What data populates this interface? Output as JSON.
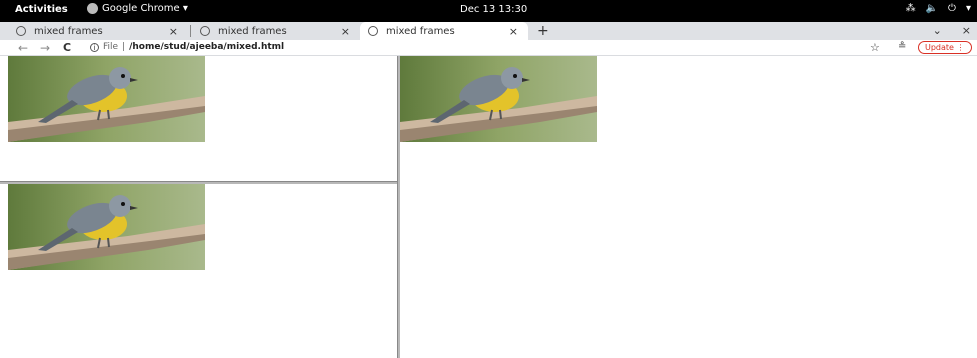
{
  "system_bar": {
    "activities": "Activities",
    "app_name": "Google Chrome ▾",
    "clock": "Dec 13  13:30",
    "tray_icons": [
      "network-icon",
      "volume-icon",
      "power-icon"
    ],
    "tray_menu": "▾"
  },
  "tabs": [
    {
      "label": "mixed frames",
      "close": "×",
      "active": false
    },
    {
      "label": "mixed frames",
      "close": "×",
      "active": false
    },
    {
      "label": "mixed frames",
      "close": "×",
      "active": true
    }
  ],
  "new_tab": "+",
  "window_controls": {
    "minimize": "⌄",
    "close": "×"
  },
  "toolbar": {
    "back": "←",
    "forward": "→",
    "reload": "C",
    "info": "i",
    "scheme": "File",
    "url": "/home/stud/ajeeba/mixed.html",
    "bookmark": "☆",
    "profile": "≗",
    "update_label": "Update ⋮"
  },
  "frames": {
    "top_left_image": "bird-photo",
    "bottom_left_image": "bird-photo",
    "right_image": "bird-photo"
  }
}
